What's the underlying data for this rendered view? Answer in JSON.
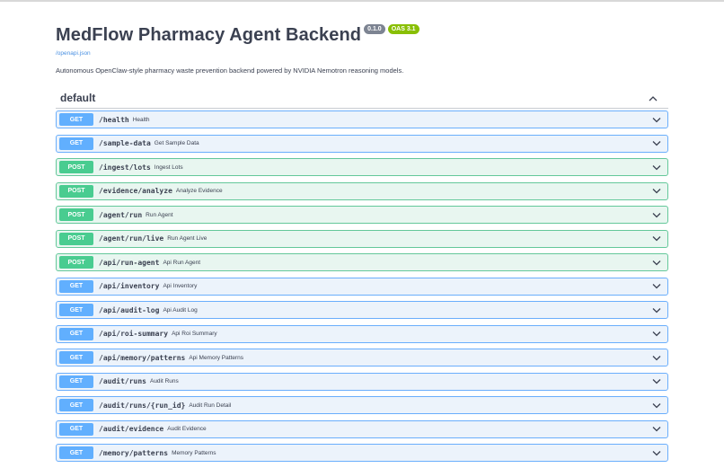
{
  "app": {
    "title": "MedFlow Pharmacy Agent Backend",
    "version_badge": "0.1.0",
    "oas_badge": "OAS 3.1",
    "spec_link": "/openapi.json",
    "description": "Autonomous OpenClaw-style pharmacy waste prevention backend powered by NVIDIA Nemotron reasoning models."
  },
  "section": {
    "title": "default",
    "toggle_icon": "chevron-up-icon"
  },
  "colors": {
    "get_accent": "#61affe",
    "get_background": "#ecf3fb",
    "post_accent": "#49cc90",
    "post_background": "#e8f6f0",
    "version_badge": "#7d8492",
    "oas_badge": "#89bf04"
  },
  "operations": [
    {
      "method": "GET",
      "path": "/health",
      "summary": "Health"
    },
    {
      "method": "GET",
      "path": "/sample-data",
      "summary": "Get Sample Data"
    },
    {
      "method": "POST",
      "path": "/ingest/lots",
      "summary": "Ingest Lots"
    },
    {
      "method": "POST",
      "path": "/evidence/analyze",
      "summary": "Analyze Evidence"
    },
    {
      "method": "POST",
      "path": "/agent/run",
      "summary": "Run Agent"
    },
    {
      "method": "POST",
      "path": "/agent/run/live",
      "summary": "Run Agent Live"
    },
    {
      "method": "POST",
      "path": "/api/run-agent",
      "summary": "Api Run Agent"
    },
    {
      "method": "GET",
      "path": "/api/inventory",
      "summary": "Api Inventory"
    },
    {
      "method": "GET",
      "path": "/api/audit-log",
      "summary": "Api Audit Log"
    },
    {
      "method": "GET",
      "path": "/api/roi-summary",
      "summary": "Api Roi Summary"
    },
    {
      "method": "GET",
      "path": "/api/memory/patterns",
      "summary": "Api Memory Patterns"
    },
    {
      "method": "GET",
      "path": "/audit/runs",
      "summary": "Audit Runs"
    },
    {
      "method": "GET",
      "path": "/audit/runs/{run_id}",
      "summary": "Audit Run Detail"
    },
    {
      "method": "GET",
      "path": "/audit/evidence",
      "summary": "Audit Evidence"
    },
    {
      "method": "GET",
      "path": "/memory/patterns",
      "summary": "Memory Patterns"
    }
  ]
}
